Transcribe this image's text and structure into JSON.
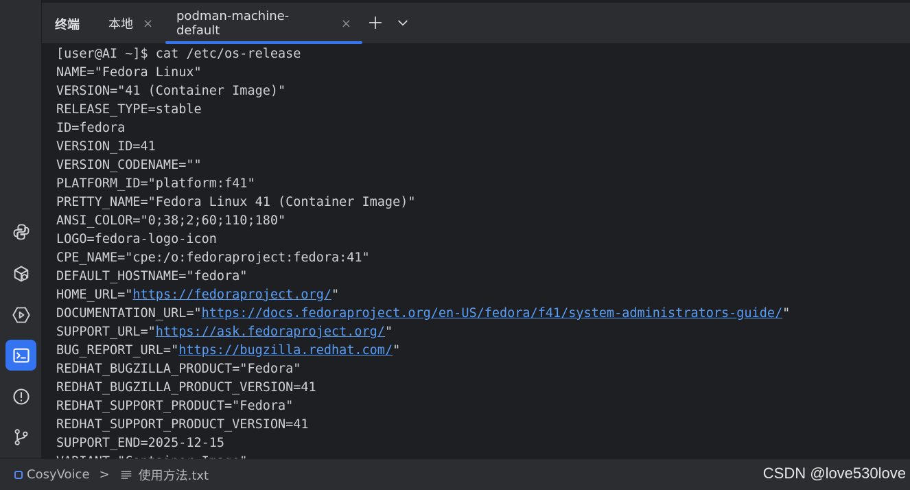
{
  "tool_window": {
    "title": "终端"
  },
  "tabs": [
    {
      "label": "本地",
      "close": "×",
      "active": false
    },
    {
      "label": "podman-machine-default",
      "close": "×",
      "active": true
    }
  ],
  "tab_actions": {
    "add_icon": "plus-icon",
    "menu_icon": "chevron-down-icon"
  },
  "sidebar": [
    {
      "name": "python-icon",
      "active": false
    },
    {
      "name": "services-icon",
      "active": false
    },
    {
      "name": "run-icon",
      "active": false
    },
    {
      "name": "terminal-icon",
      "active": true
    },
    {
      "name": "problems-icon",
      "active": false
    },
    {
      "name": "git-icon",
      "active": false
    }
  ],
  "terminal": {
    "lines": [
      {
        "text": "[user@AI ~]$ cat /etc/os-release"
      },
      {
        "text": "NAME=\"Fedora Linux\""
      },
      {
        "text": "VERSION=\"41 (Container Image)\""
      },
      {
        "text": "RELEASE_TYPE=stable"
      },
      {
        "text": "ID=fedora"
      },
      {
        "text": "VERSION_ID=41"
      },
      {
        "text": "VERSION_CODENAME=\"\""
      },
      {
        "text": "PLATFORM_ID=\"platform:f41\""
      },
      {
        "text": "PRETTY_NAME=\"Fedora Linux 41 (Container Image)\""
      },
      {
        "text": "ANSI_COLOR=\"0;38;2;60;110;180\""
      },
      {
        "text": "LOGO=fedora-logo-icon"
      },
      {
        "text": "CPE_NAME=\"cpe:/o:fedoraproject:fedora:41\""
      },
      {
        "text": "DEFAULT_HOSTNAME=\"fedora\""
      },
      {
        "prefix": "HOME_URL=\"",
        "link": "https://fedoraproject.org/",
        "suffix": "\""
      },
      {
        "prefix": "DOCUMENTATION_URL=\"",
        "link": "https://docs.fedoraproject.org/en-US/fedora/f41/system-administrators-guide/",
        "suffix": "\""
      },
      {
        "prefix": "SUPPORT_URL=\"",
        "link": "https://ask.fedoraproject.org/",
        "suffix": "\""
      },
      {
        "prefix": "BUG_REPORT_URL=\"",
        "link": "https://bugzilla.redhat.com/",
        "suffix": "\""
      },
      {
        "text": "REDHAT_BUGZILLA_PRODUCT=\"Fedora\""
      },
      {
        "text": "REDHAT_BUGZILLA_PRODUCT_VERSION=41"
      },
      {
        "text": "REDHAT_SUPPORT_PRODUCT=\"Fedora\""
      },
      {
        "text": "REDHAT_SUPPORT_PRODUCT_VERSION=41"
      },
      {
        "text": "SUPPORT_END=2025-12-15"
      },
      {
        "text": "VARIANT=\"Container Image\""
      }
    ]
  },
  "statusbar": {
    "project": "CosyVoice",
    "separator": ">",
    "file": "使用方法.txt",
    "watermark": "CSDN @love530love"
  },
  "colors": {
    "accent": "#3574f0",
    "link": "#589df6",
    "text": "#cfd1d4",
    "background": "#1e1f22",
    "panel": "#2b2d30"
  }
}
